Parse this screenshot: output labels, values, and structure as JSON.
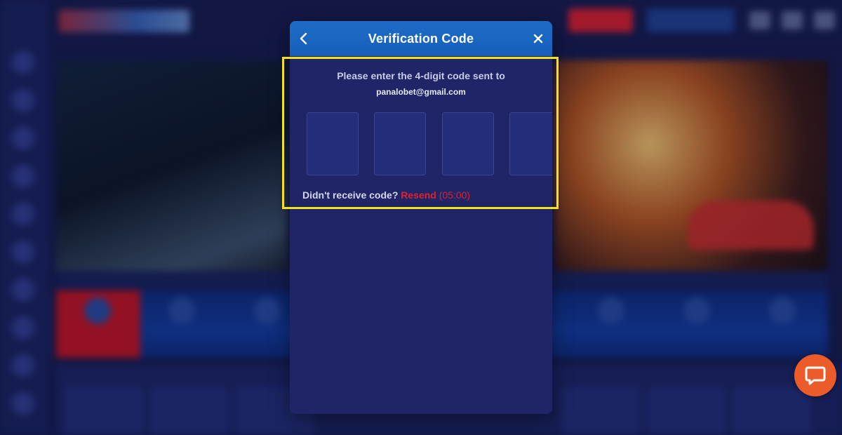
{
  "modal": {
    "title": "Verification Code",
    "back_icon": "chevron-left-icon",
    "close_icon": "close-icon",
    "instruction": "Please enter the 4-digit code sent to",
    "email": "panalobet@gmail.com",
    "code_digits": [
      "",
      "",
      "",
      ""
    ],
    "resend_prompt": "Didn't receive code?",
    "resend_label": "Resend",
    "countdown": "(05:00)"
  },
  "highlight_color": "#f2e11d",
  "chat_widget": {
    "icon": "chat-bubble-icon",
    "color": "#ec5c2a"
  }
}
